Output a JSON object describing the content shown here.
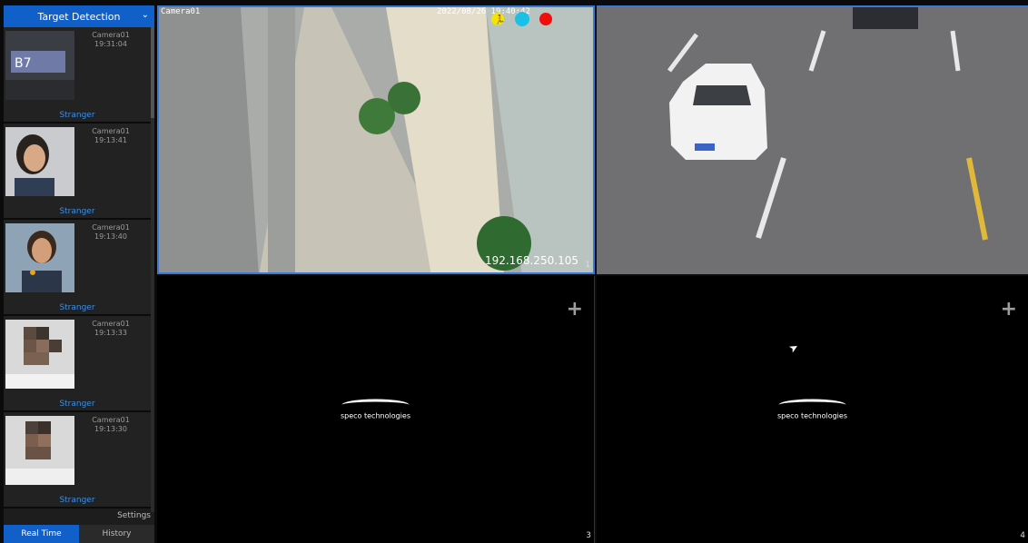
{
  "sidebar": {
    "title": "Target Detection",
    "events": [
      {
        "camera": "Camera01",
        "time": "19:31:04",
        "label": "Stranger",
        "thumb": "plate"
      },
      {
        "camera": "Camera01",
        "time": "19:13:41",
        "label": "Stranger",
        "thumb": "face"
      },
      {
        "camera": "Camera01",
        "time": "19:13:40",
        "label": "Stranger",
        "thumb": "face"
      },
      {
        "camera": "Camera01",
        "time": "19:13:33",
        "label": "Stranger",
        "thumb": "blurred"
      },
      {
        "camera": "Camera01",
        "time": "19:13:30",
        "label": "Stranger",
        "thumb": "blurred"
      }
    ],
    "settings_label": "Settings",
    "tabs": [
      {
        "label": "Real Time",
        "active": true
      },
      {
        "label": "History",
        "active": false
      }
    ]
  },
  "grid": {
    "cell1": {
      "camera_name": "Camera01",
      "timestamp": "2022/08/26 19:40:42",
      "ip": "192.168.250.105",
      "channel": "1"
    },
    "cell2": {
      "channel": ""
    },
    "cell3": {
      "channel": "3",
      "logo": "speco technologies"
    },
    "cell4": {
      "channel": "4",
      "logo": "speco technologies"
    }
  },
  "colors": {
    "accent": "#1160c9",
    "label": "#3b8fe8"
  }
}
